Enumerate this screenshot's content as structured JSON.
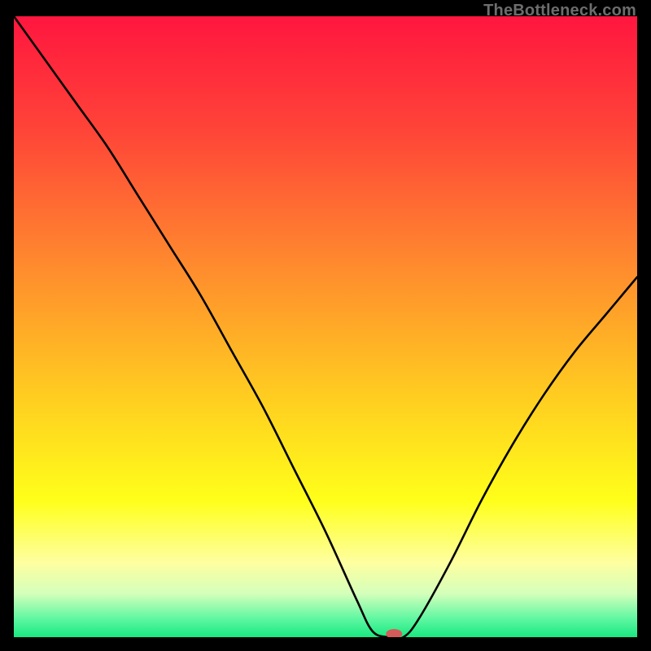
{
  "watermark": "TheBottleneck.com",
  "chart_data": {
    "type": "line",
    "title": "",
    "xlabel": "",
    "ylabel": "",
    "xlim": [
      0,
      100
    ],
    "ylim": [
      0,
      100
    ],
    "grid": false,
    "legend": false,
    "series": [
      {
        "name": "bottleneck-curve",
        "x": [
          0,
          5,
          10,
          15,
          20,
          25,
          30,
          35,
          40,
          45,
          50,
          55,
          57.5,
          60,
          62.5,
          65,
          70,
          75,
          80,
          85,
          90,
          95,
          100
        ],
        "values": [
          100,
          93,
          86,
          79,
          71,
          63,
          55,
          46,
          37,
          27,
          17,
          6,
          1,
          0,
          0,
          3,
          12,
          22,
          31,
          39,
          46,
          52,
          58
        ]
      }
    ],
    "marker": {
      "x": 61,
      "y": 0,
      "color": "#d65a5a"
    },
    "background_gradient": {
      "stops": [
        {
          "offset": 0.0,
          "color": "#ff163f"
        },
        {
          "offset": 0.18,
          "color": "#ff4338"
        },
        {
          "offset": 0.4,
          "color": "#ff8a2e"
        },
        {
          "offset": 0.6,
          "color": "#ffc921"
        },
        {
          "offset": 0.78,
          "color": "#ffff1a"
        },
        {
          "offset": 0.88,
          "color": "#feffa0"
        },
        {
          "offset": 0.93,
          "color": "#d4ffbb"
        },
        {
          "offset": 0.97,
          "color": "#60f7a2"
        },
        {
          "offset": 1.0,
          "color": "#18e880"
        }
      ]
    }
  }
}
